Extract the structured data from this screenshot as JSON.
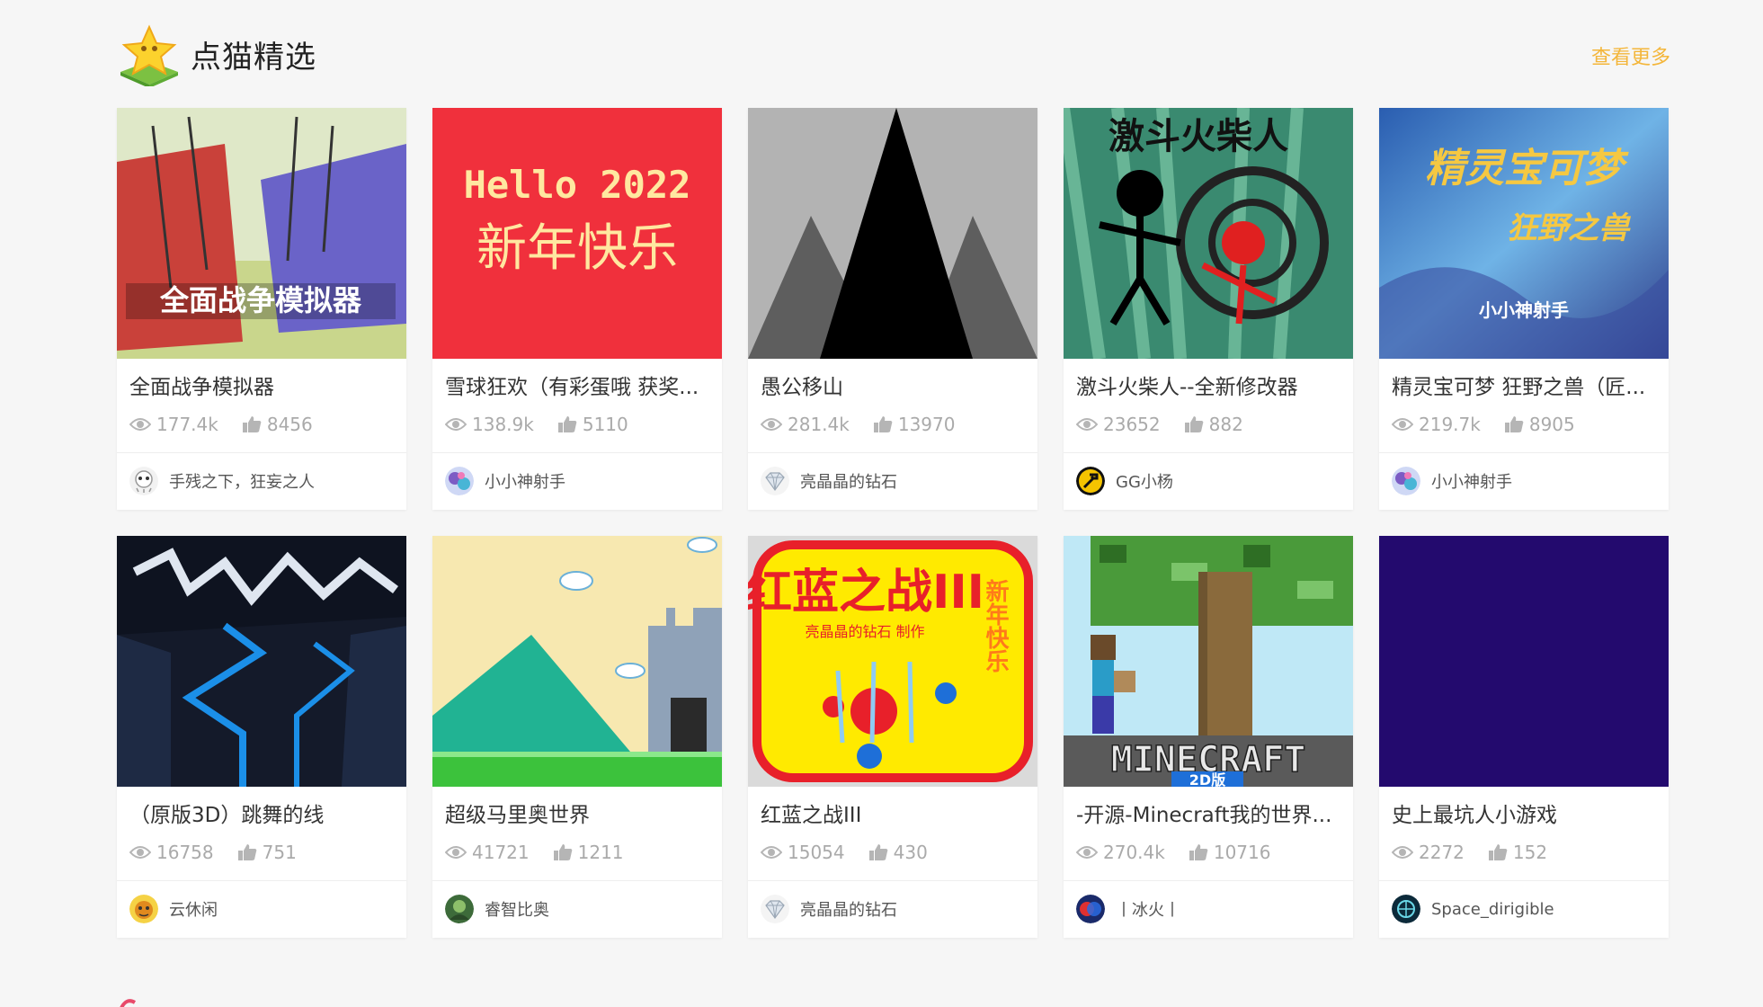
{
  "section": {
    "title": "点猫精选",
    "more_label": "查看更多",
    "logo_icon": "star-trophy-icon"
  },
  "colors": {
    "accent": "#f4b63a",
    "meta_text": "#aaaaaa"
  },
  "cards": [
    {
      "title": "全面战争模拟器",
      "views": "177.4k",
      "likes": "8456",
      "author": "手残之下，狂妄之人",
      "thumb_text": "全面战争模拟器"
    },
    {
      "title": "雪球狂欢（有彩蛋哦 获奖...",
      "views": "138.9k",
      "likes": "5110",
      "author": "小小神射手",
      "thumb_text": "Hello 2022",
      "thumb_text2": "新年快乐"
    },
    {
      "title": "愚公移山",
      "views": "281.4k",
      "likes": "13970",
      "author": "亮晶晶的钻石"
    },
    {
      "title": "激斗火柴人--全新修改器",
      "views": "23652",
      "likes": "882",
      "author": "GG小杨",
      "thumb_text": "激斗火柴人"
    },
    {
      "title": "精灵宝可梦 狂野之兽（匠...",
      "views": "219.7k",
      "likes": "8905",
      "author": "小小神射手",
      "thumb_text": "精灵宝可梦",
      "thumb_text2": "狂野之兽",
      "thumb_text3": "小小神射手"
    },
    {
      "title": "（原版3D）跳舞的线",
      "views": "16758",
      "likes": "751",
      "author": "云休闲"
    },
    {
      "title": "超级马里奥世界",
      "views": "41721",
      "likes": "1211",
      "author": "睿智比奥"
    },
    {
      "title": "红蓝之战III",
      "views": "15054",
      "likes": "430",
      "author": "亮晶晶的钻石",
      "thumb_text": "红蓝之战III",
      "thumb_text2": "亮晶晶的钻石 制作",
      "thumb_text3": "新年快乐"
    },
    {
      "title": "-开源-Minecraft我的世界...",
      "views": "270.4k",
      "likes": "10716",
      "author": "丨冰火丨",
      "thumb_text": "MINECRAFT",
      "thumb_text2": "2D版"
    },
    {
      "title": "史上最坑人小游戏",
      "views": "2272",
      "likes": "152",
      "author": "Space_dirigible"
    }
  ]
}
